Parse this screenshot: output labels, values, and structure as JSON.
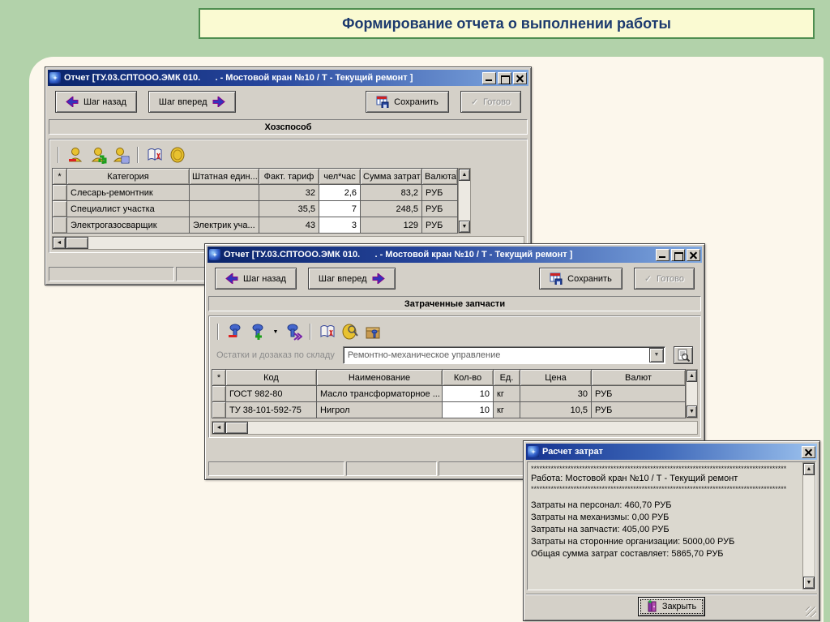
{
  "banner": {
    "title": "Формирование отчета о выполнении работы"
  },
  "report_window_title": "Отчет [ТУ.03.СПТООО.ЭМК 010.      . - Мостовой кран №10 / Т - Текущий ремонт ]",
  "nav": {
    "back": "Шаг назад",
    "forward": "Шаг вперед",
    "save": "Сохранить",
    "done": "Готово"
  },
  "icons": {
    "scroll_up": "▲",
    "scroll_down": "▼",
    "scroll_left": "◄",
    "dropdown": "▼",
    "check": "✓"
  },
  "window1": {
    "section": "Хозспособ",
    "table": {
      "headers": [
        "*",
        "Категория",
        "Штатная един...",
        "Факт. тариф",
        "чел*час",
        "Сумма затрат",
        "Валюта"
      ],
      "rows": [
        [
          "Слесарь-ремонтник",
          "",
          "32",
          "2,6",
          "83,2",
          "РУБ"
        ],
        [
          "Специалист участка",
          "",
          "35,5",
          "7",
          "248,5",
          "РУБ"
        ],
        [
          "Электрогазосварщик",
          "Электрик уча...",
          "43",
          "3",
          "129",
          "РУБ"
        ]
      ]
    }
  },
  "window2": {
    "section": "Затраченные запчасти",
    "stock": {
      "label": "Остатки и дозаказ по складу",
      "value": "Ремонтно-механическое управление"
    },
    "table": {
      "headers": [
        "*",
        "Код",
        "Наименование",
        "Кол-во",
        "Ед.",
        "Цена",
        "Валют"
      ],
      "rows": [
        [
          "ГОСТ 982-80",
          "Масло трансформаторное ...",
          "10",
          "кг",
          "30",
          "РУБ"
        ],
        [
          "ТУ 38-101-592-75",
          "Нигрол",
          "10",
          "кг",
          "10,5",
          "РУБ"
        ]
      ]
    }
  },
  "window3": {
    "title": "Расчет затрат",
    "separator": "******************************************************************************************",
    "work_line": "Работа: Мостовой кран №10 / Т - Текущий ремонт",
    "cost_lines": [
      "Затраты на персонал: 460,70 РУБ",
      "Затраты на механизмы: 0,00 РУБ",
      "Затраты на запчасти: 405,00 РУБ",
      "Затраты на сторонние организации: 5000,00 РУБ",
      "Общая сумма затрат составляет: 5865,70 РУБ"
    ],
    "close": "Закрыть"
  },
  "colors": {
    "accent_green": "#4e8e50",
    "banner_bg": "#fafad2",
    "banner_text": "#1c3a6e",
    "titlebar_navy": "#0a246a",
    "desktop_green": "#b2d2aa",
    "panel_cream": "#fcf7ec",
    "window_face": "#d4d0c8"
  }
}
